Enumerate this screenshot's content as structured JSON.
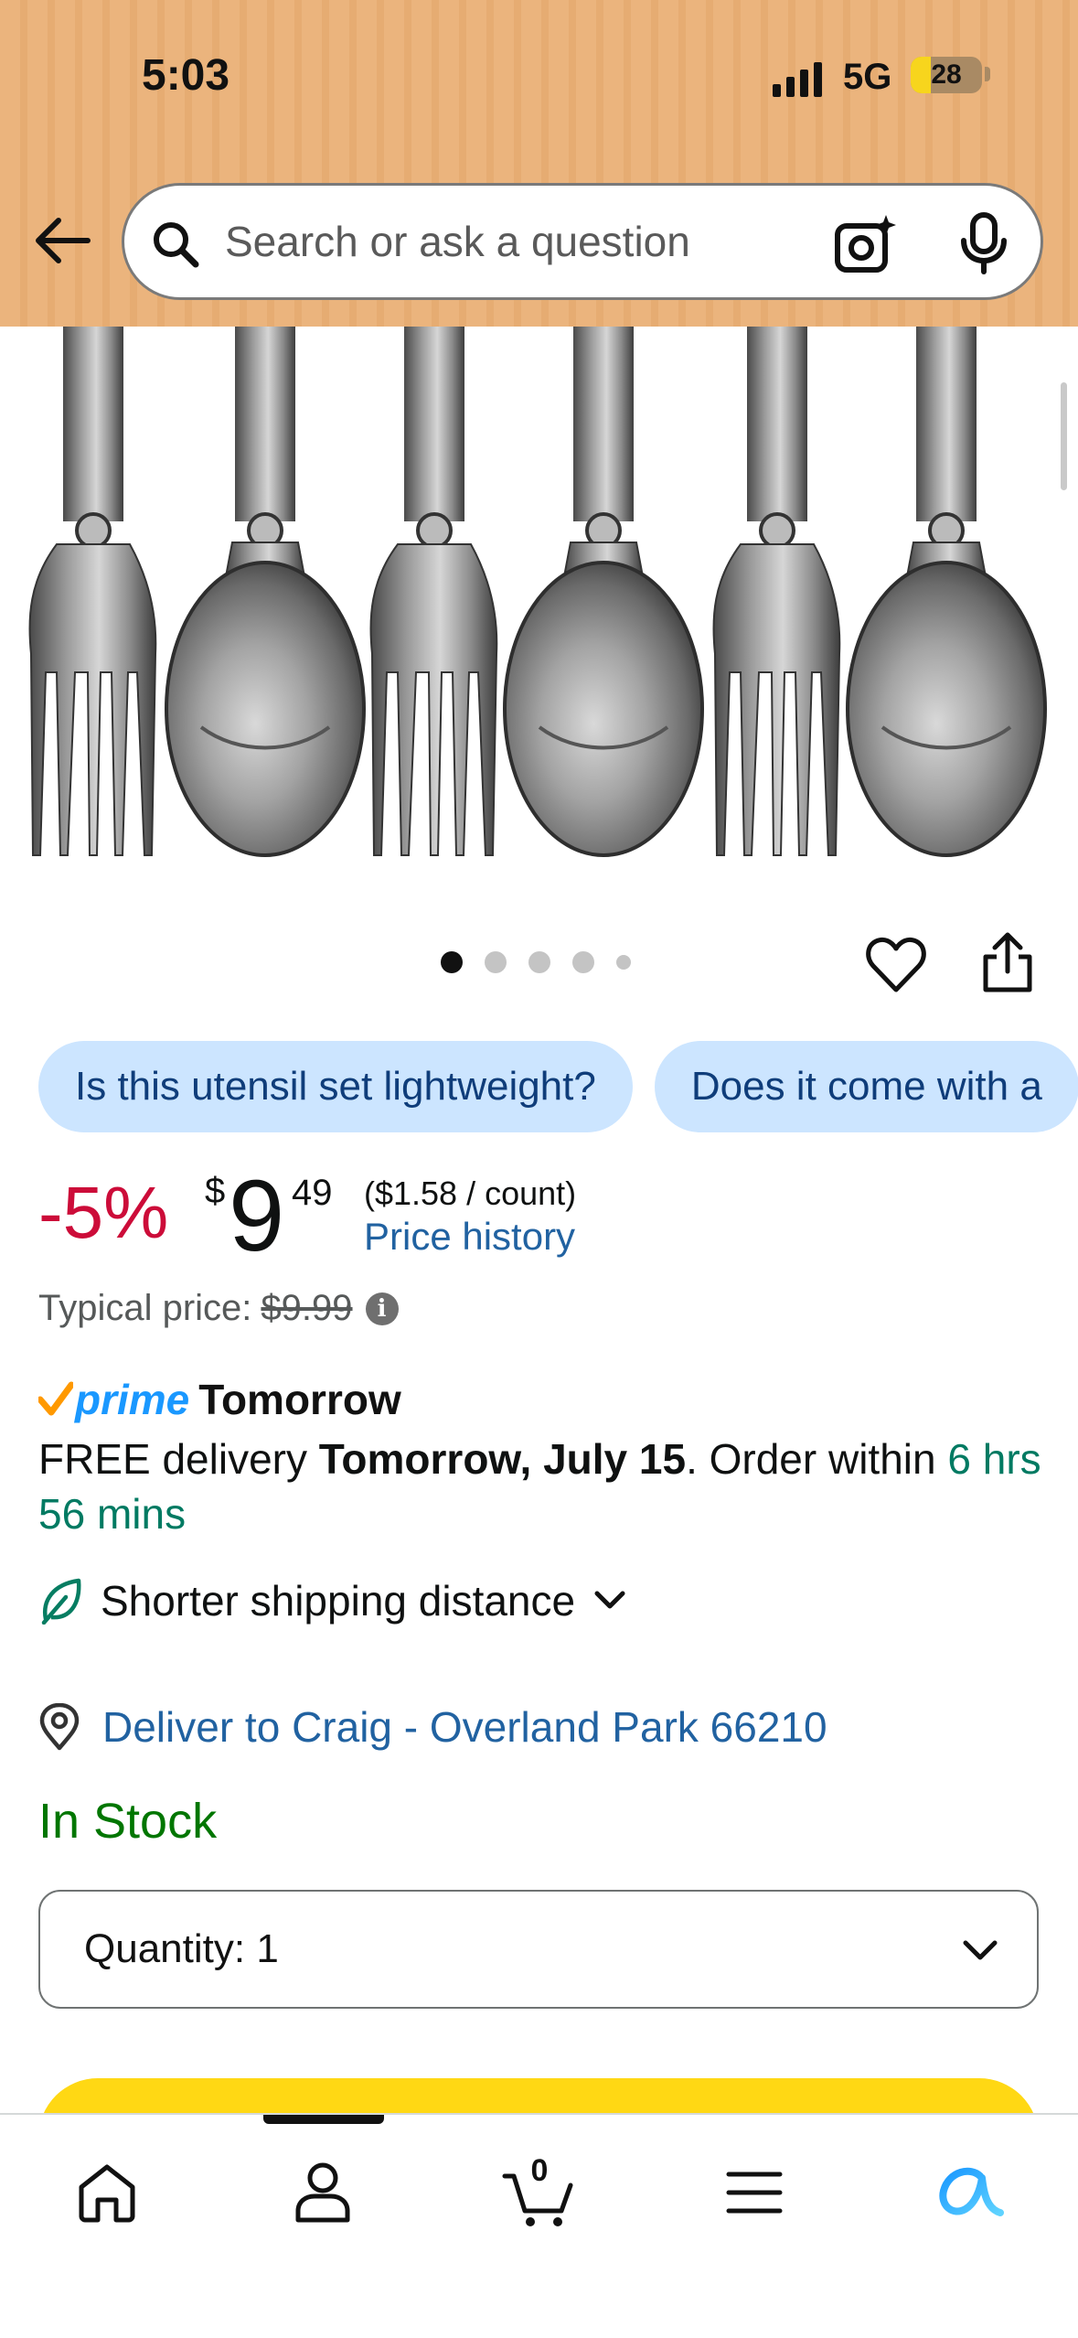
{
  "status_bar": {
    "time": "5:03",
    "network": "5G",
    "battery": "28"
  },
  "search": {
    "placeholder": "Search or ask a question"
  },
  "product": {
    "image_pagination": {
      "total_dots": 5,
      "active_index": 0
    }
  },
  "chips": [
    "Is this utensil set lightweight?",
    "Does it come with a"
  ],
  "price": {
    "discount": "-5%",
    "currency": "$",
    "whole": "9",
    "fraction": "49",
    "unit_price": "($1.58 / count)",
    "history_link": "Price history",
    "typical_label": "Typical price:",
    "typical_value": "$9.99"
  },
  "prime": {
    "word": "prime",
    "day": "Tomorrow"
  },
  "delivery": {
    "prefix": "FREE delivery ",
    "date": "Tomorrow, July 15",
    "middle": ". Order within ",
    "countdown": "6 hrs 56 mins"
  },
  "shipping": {
    "label": "Shorter shipping distance"
  },
  "deliver_to": {
    "label": "Deliver to Craig - Overland Park 66210"
  },
  "stock": {
    "status": "In Stock"
  },
  "quantity": {
    "label": "Quantity:",
    "value": "1"
  },
  "bottom_nav": {
    "cart_count": "0",
    "items": [
      "home-icon",
      "profile-icon",
      "cart-icon",
      "menu-icon",
      "rufus-icon"
    ]
  },
  "colors": {
    "header_bg": "#ebb47d",
    "discount_red": "#cc0c39",
    "link_blue": "#2162a1",
    "stock_green": "#007600",
    "countdown_green": "#007a62",
    "chip_bg": "#cce5ff",
    "buy_button_yellow": "#ffd814",
    "prime_blue": "#1a98ff"
  }
}
